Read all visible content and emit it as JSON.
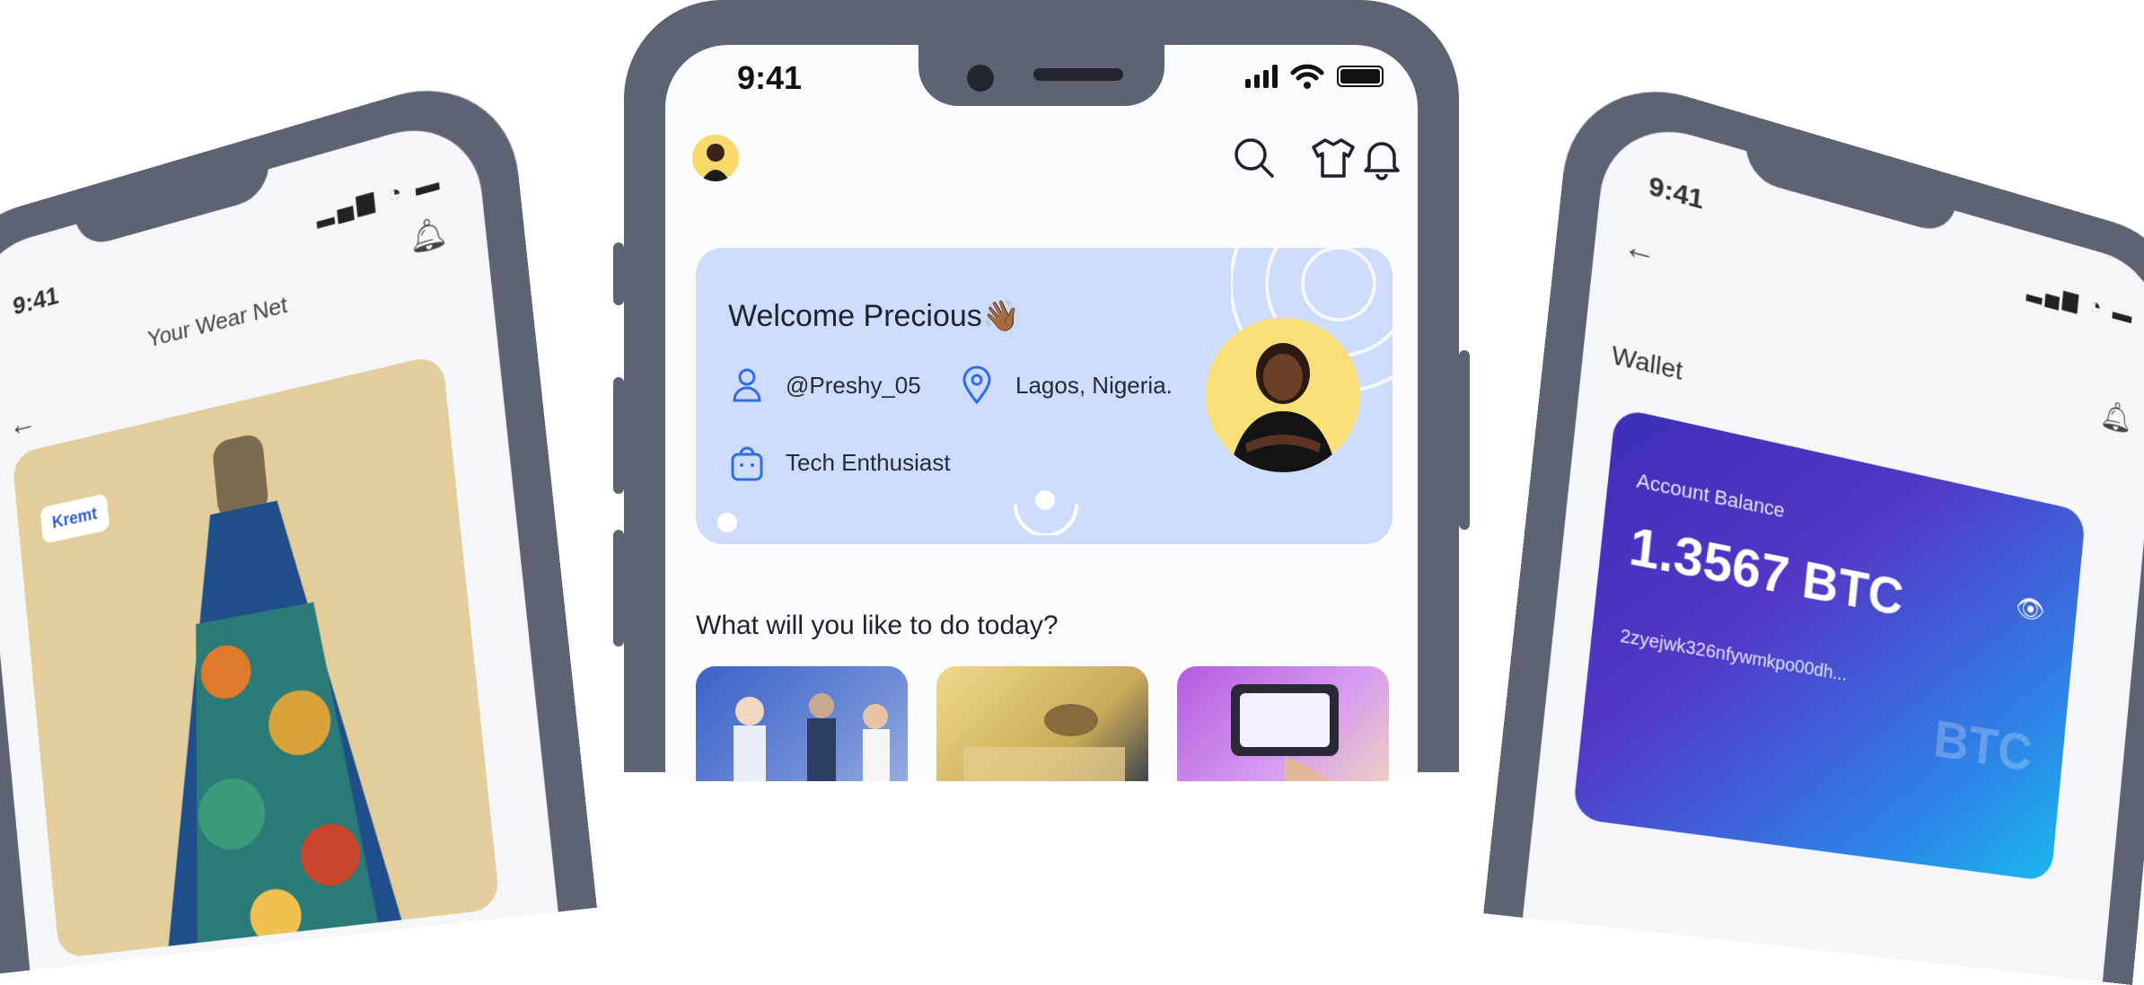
{
  "left_phone": {
    "time": "9:41",
    "title": "Your Wear Net",
    "badge": "Kremt",
    "icons": [
      "back-arrow-icon",
      "bell-icon",
      "signal-icon",
      "wifi-icon",
      "battery-icon"
    ]
  },
  "center_phone": {
    "time": "9:41",
    "icons": [
      "search-icon",
      "tshirt-icon",
      "bell-icon",
      "signal-icon",
      "wifi-icon",
      "battery-icon"
    ],
    "welcome": {
      "title": "Welcome Precious👋🏾",
      "username": "@Preshy_05",
      "location": "Lagos, Nigeria.",
      "occupation": "Tech Enthusiast"
    },
    "question": "What will you like to do today?",
    "colors": {
      "card_bg": "#cddcfb",
      "accent_blue": "#2f6ee8",
      "frame": "#5d6372"
    }
  },
  "right_phone": {
    "time": "9:41",
    "wallet_label": "Wallet",
    "account_balance_label": "Account Balance",
    "amount": "1.3567 BTC",
    "address": "2zyejwk326nfywmkpo00dh...",
    "watermark": "BTC",
    "icons": [
      "back-arrow-icon",
      "bell-icon",
      "eye-icon",
      "copy-icon"
    ]
  }
}
